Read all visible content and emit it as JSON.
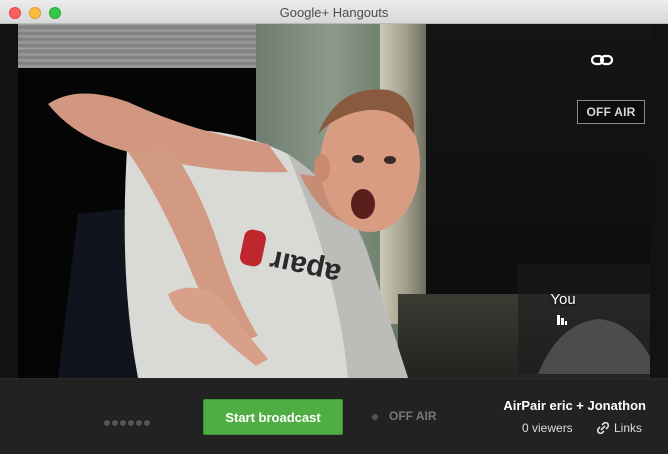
{
  "window": {
    "title": "Google+ Hangouts"
  },
  "video": {
    "off_air_badge": "OFF AIR",
    "self_label": "You",
    "link_icon": "link-icon",
    "mic_icon": "signal-icon"
  },
  "toolbar": {
    "start_broadcast": "Start broadcast",
    "status_text": "OFF AIR",
    "hangout_name": "AirPair eric + Jonathon",
    "viewers": "0 viewers",
    "links_label": "Links"
  },
  "colors": {
    "accent_green": "#4fae43",
    "toolbar_bg": "#222222",
    "close": "#fc605c",
    "minimize": "#fdbc40",
    "maximize": "#34c84a"
  }
}
